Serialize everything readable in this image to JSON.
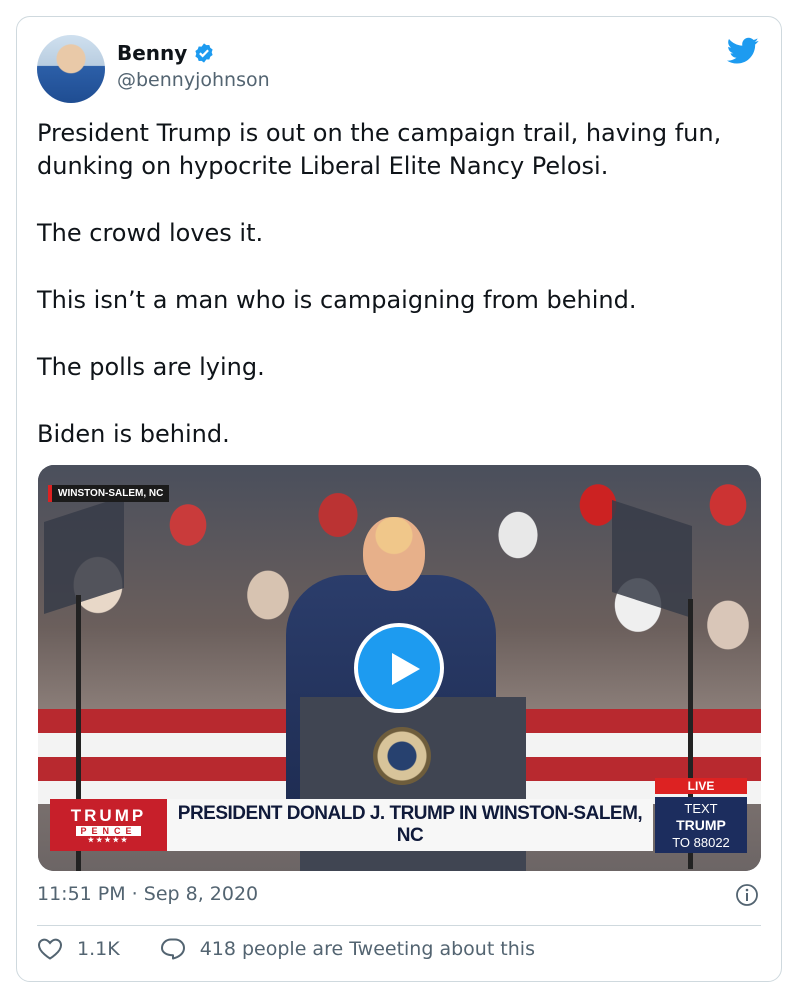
{
  "author": {
    "name": "Benny",
    "handle": "@bennyjohnson"
  },
  "tweet": {
    "paragraphs": [
      "President Trump is out on the campaign trail, having fun, dunking on hypocrite Liberal Elite Nancy Pelosi.",
      "The crowd loves it.",
      "This isn’t a man who is campaigning from behind.",
      "The polls are lying.",
      "Biden is behind."
    ]
  },
  "video": {
    "location_tag": "WINSTON-SALEM, NC",
    "brand_top": "TRUMP",
    "brand_mid": "PENCE",
    "brand_stars": "★★★★★",
    "headline": "PRESIDENT DONALD J. TRUMP IN WINSTON-SALEM, NC",
    "live_label": "LIVE",
    "text_line1": "TEXT",
    "text_line2": "TRUMP",
    "text_line3": "TO 88022"
  },
  "meta": {
    "timestamp": "11:51 PM · Sep 8, 2020"
  },
  "actions": {
    "likes": "1.1K",
    "conversation": "418 people are Tweeting about this"
  },
  "colors": {
    "accent": "#1d9bf0",
    "secondary_text": "#536471",
    "border": "#cfd9de"
  },
  "icons": [
    "verified-badge-icon",
    "twitter-bird-icon",
    "play-icon",
    "info-icon",
    "heart-icon",
    "reply-bubble-icon"
  ]
}
